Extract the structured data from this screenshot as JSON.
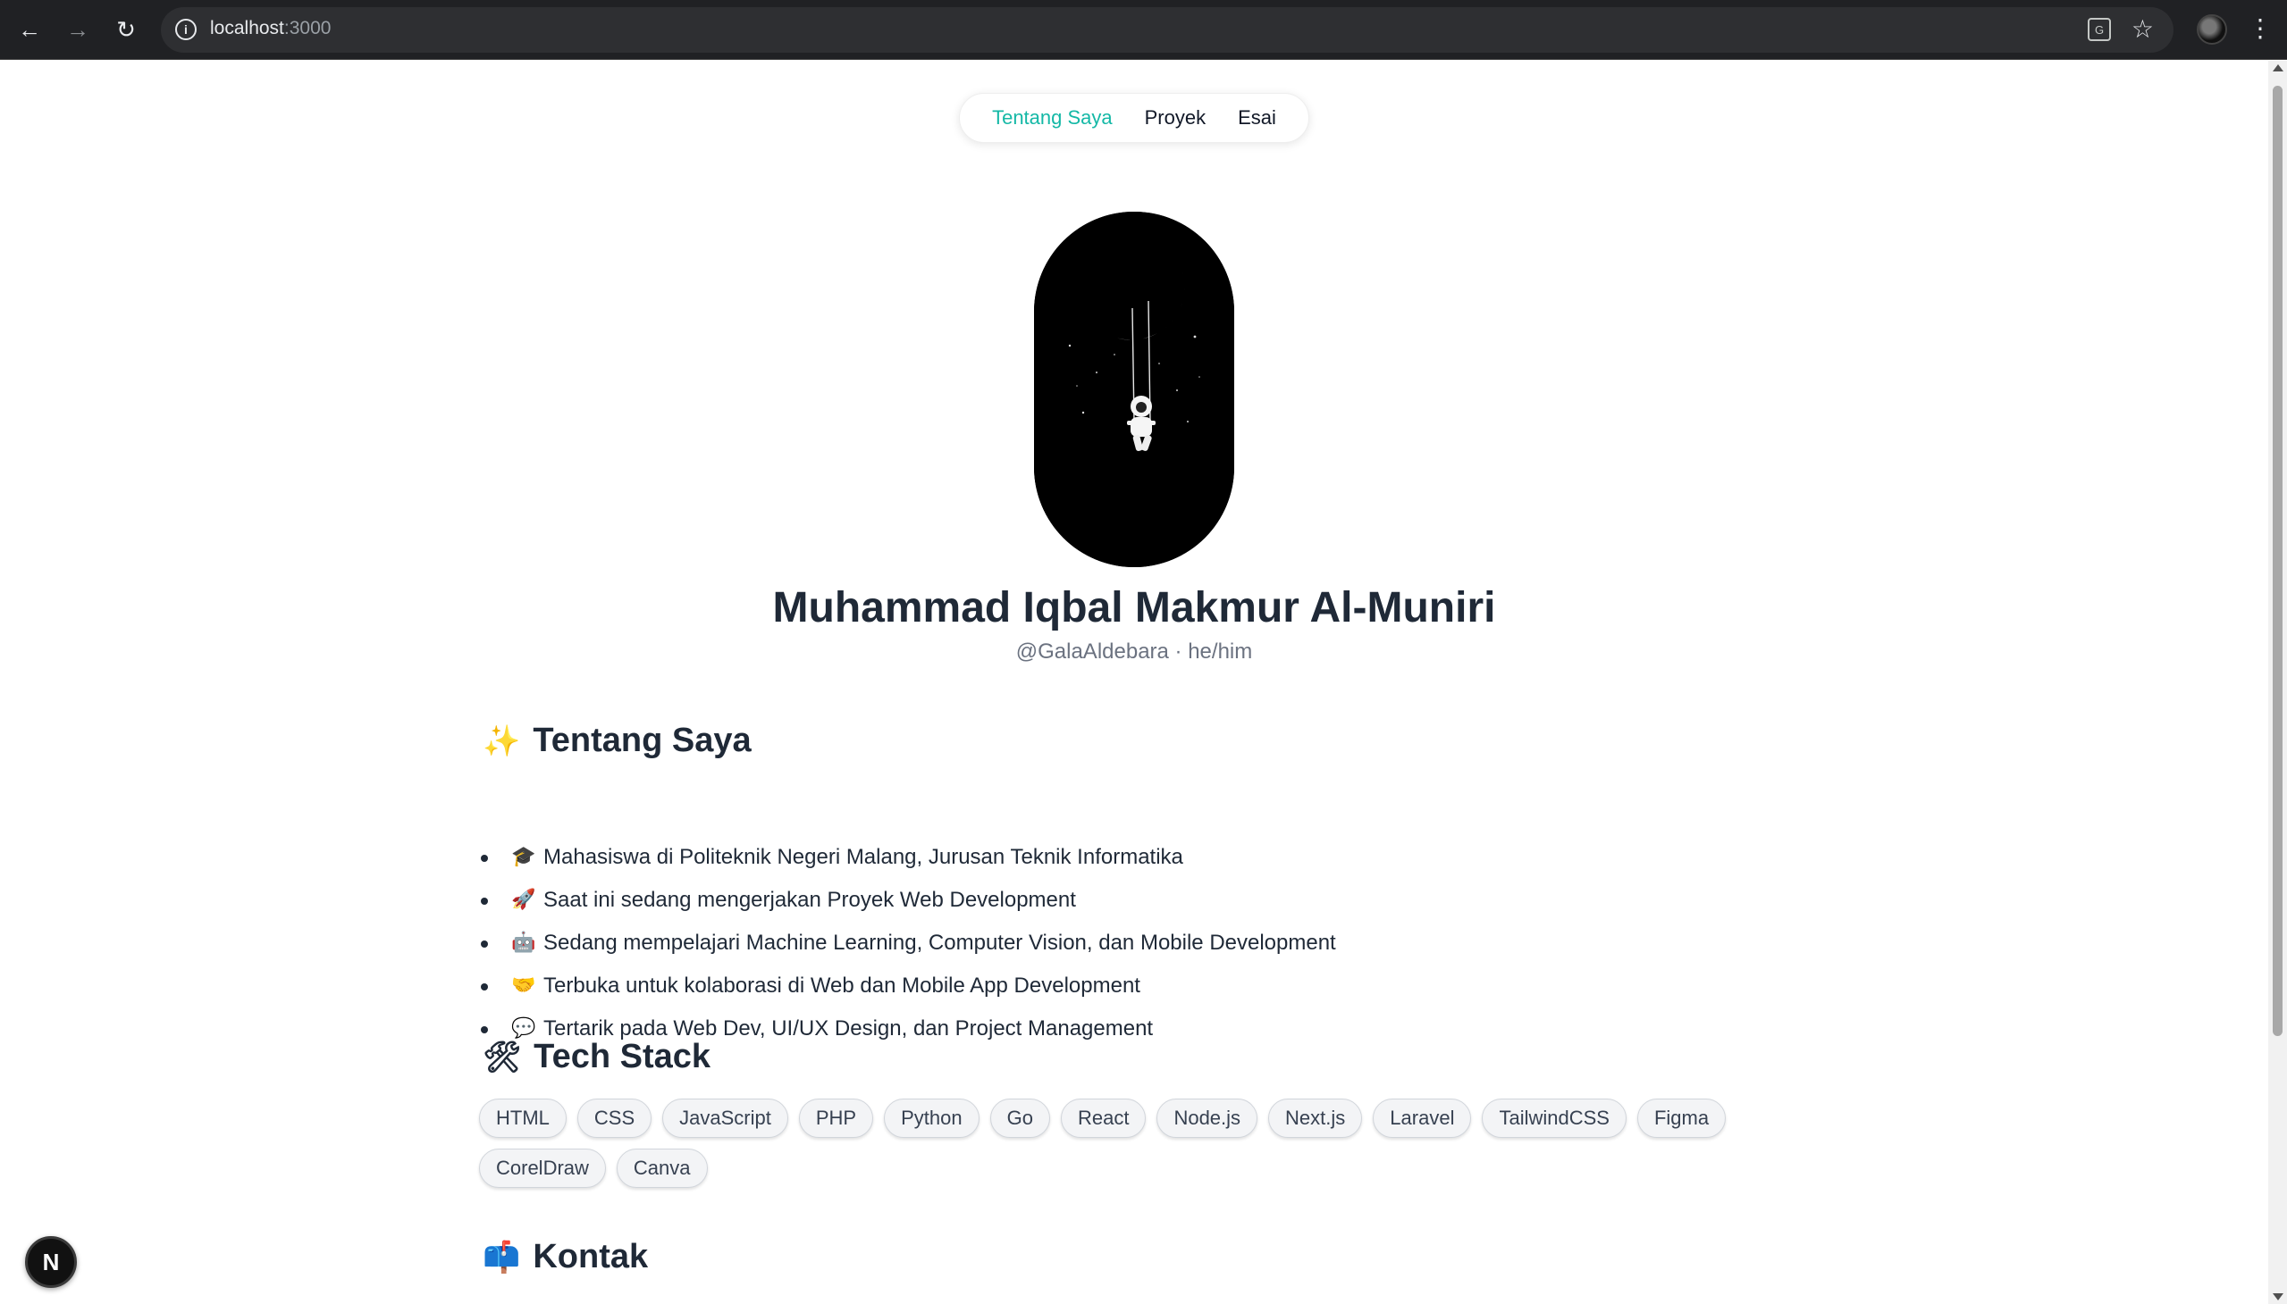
{
  "browser": {
    "url_host": "localhost",
    "url_port": ":3000",
    "icons": [
      "back-arrow-icon",
      "forward-arrow-icon",
      "reload-icon",
      "info-icon",
      "translate-icon",
      "star-icon",
      "profile-avatar",
      "kebab-menu-icon"
    ]
  },
  "nav": {
    "items": [
      {
        "label": "Tentang Saya",
        "active": true
      },
      {
        "label": "Proyek",
        "active": false
      },
      {
        "label": "Esai",
        "active": false
      }
    ],
    "active_color": "#14b8a6"
  },
  "profile": {
    "name": "Muhammad Iqbal Makmur Al-Muniri",
    "handle": "@GalaAldebara · he/him",
    "avatar_description": "astronaut-on-moon-swing"
  },
  "about": {
    "title_emoji": "✨",
    "title": "Tentang Saya",
    "items": [
      {
        "icon": "🎓",
        "text": "Mahasiswa di Politeknik Negeri Malang, Jurusan Teknik Informatika"
      },
      {
        "icon": "🚀",
        "text": "Saat ini sedang mengerjakan Proyek Web Development"
      },
      {
        "icon": "🤖",
        "text": "Sedang mempelajari Machine Learning, Computer Vision, dan Mobile Development"
      },
      {
        "icon": "🤝",
        "text": "Terbuka untuk kolaborasi di Web dan Mobile App Development"
      },
      {
        "icon": "💬",
        "text": "Tertarik pada Web Dev, UI/UX Design, dan Project Management"
      }
    ]
  },
  "tech": {
    "title_emoji": "🛠",
    "title": "Tech Stack",
    "tags": [
      "HTML",
      "CSS",
      "JavaScript",
      "PHP",
      "Python",
      "Go",
      "React",
      "Node.js",
      "Next.js",
      "Laravel",
      "TailwindCSS",
      "Figma",
      "CorelDraw",
      "Canva"
    ]
  },
  "contact": {
    "title_emoji": "📫",
    "title": "Kontak"
  },
  "dev_badge": "N"
}
